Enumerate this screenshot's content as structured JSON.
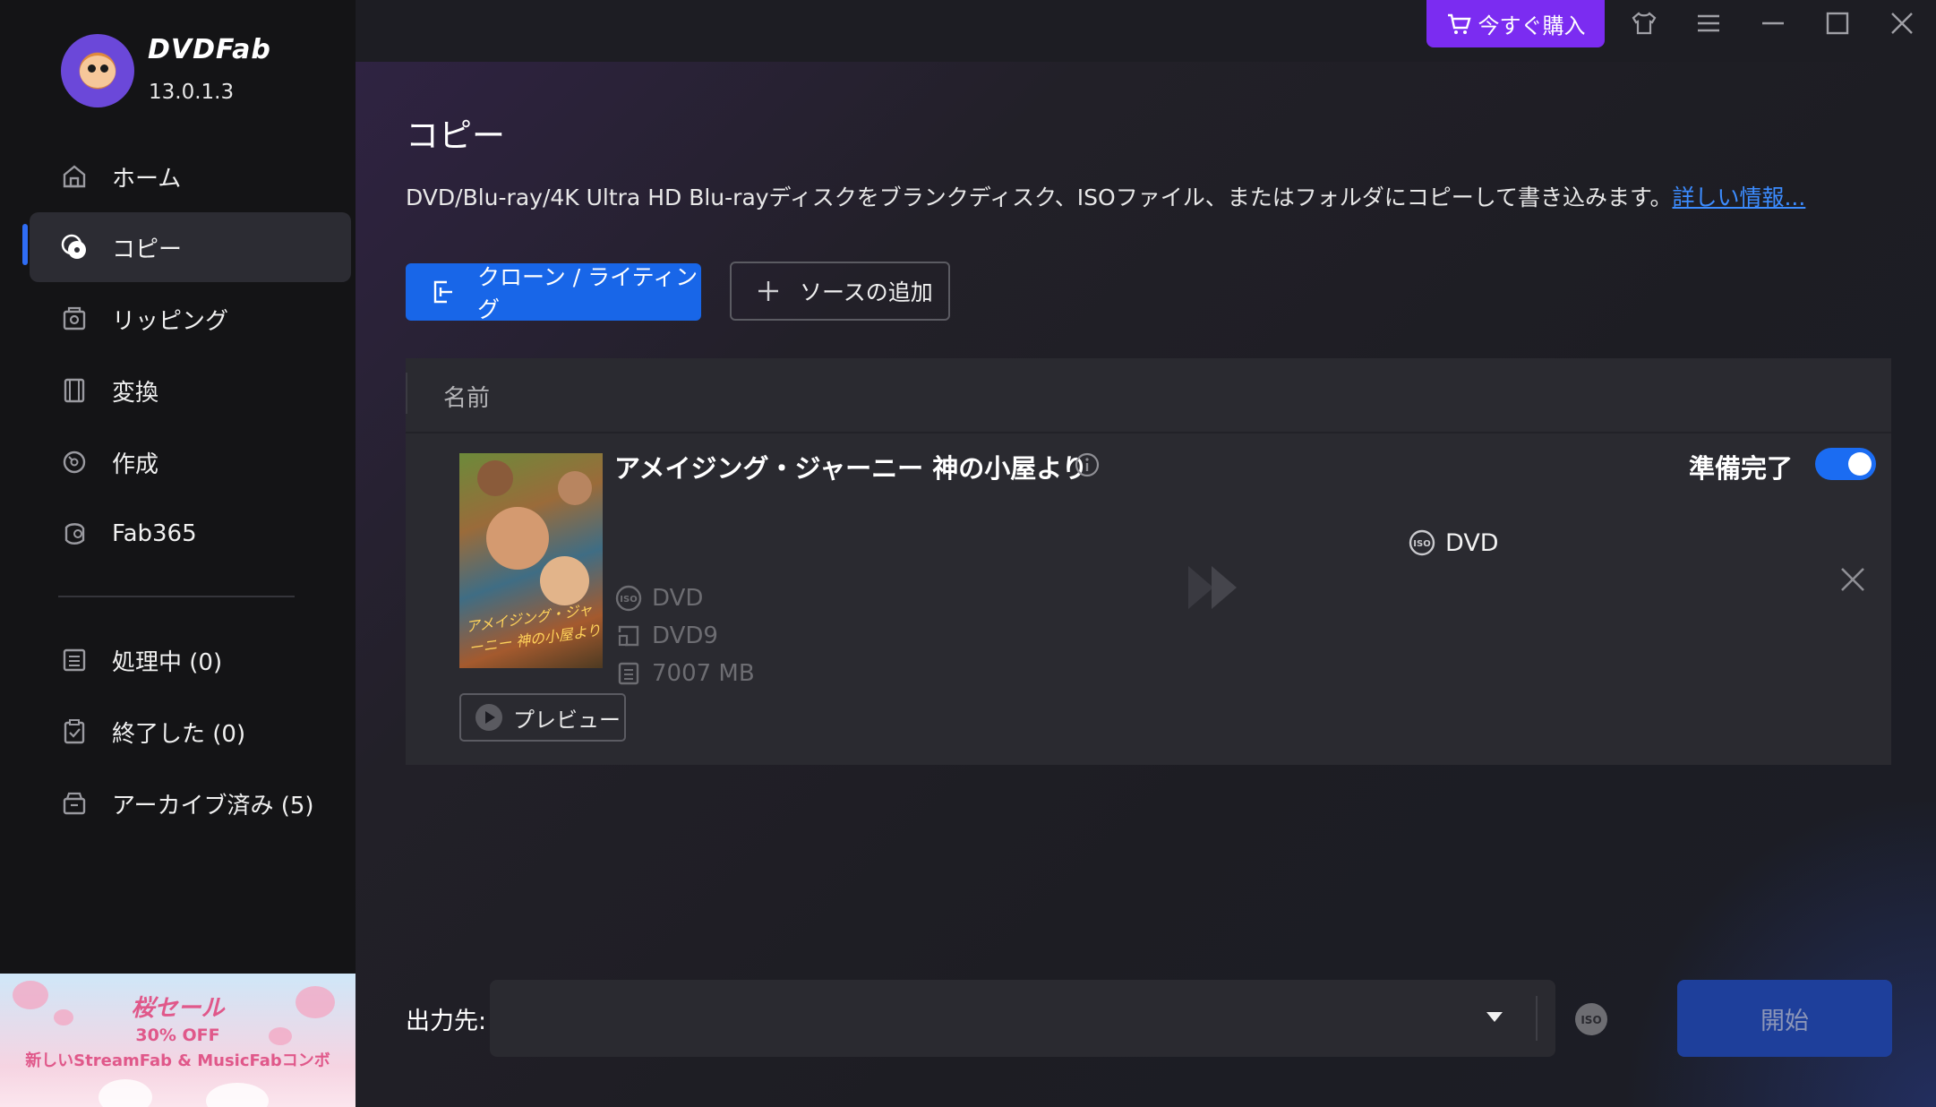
{
  "app": {
    "brand": "DVDFab",
    "version": "13.0.1.3"
  },
  "topbar": {
    "buy_label": "今すぐ購入"
  },
  "sidebar": {
    "items": [
      {
        "label": "ホーム",
        "icon": "home-icon"
      },
      {
        "label": "コピー",
        "icon": "disc-copy-icon",
        "active": true
      },
      {
        "label": "リッピング",
        "icon": "rip-icon"
      },
      {
        "label": "変換",
        "icon": "film-icon"
      },
      {
        "label": "作成",
        "icon": "create-disc-icon"
      },
      {
        "label": "Fab365",
        "icon": "fab365-icon"
      }
    ],
    "queue": [
      {
        "label": "処理中 (0)",
        "icon": "processing-list-icon"
      },
      {
        "label": "終了した (0)",
        "icon": "clipboard-check-icon"
      },
      {
        "label": "アーカイブ済み (5)",
        "icon": "archive-icon"
      }
    ],
    "promo": {
      "title": "桜セール",
      "discount": "30% OFF",
      "subtitle": "新しいStreamFab & MusicFabコンボ"
    }
  },
  "main": {
    "title": "コピー",
    "description": "DVD/Blu-ray/4K Ultra HD Blu-rayディスクをブランクディスク、ISOファイル、またはフォルダにコピーして書き込みます。",
    "more_link": "詳しい情報...",
    "clone_button": "クローン / ライティング",
    "add_source_button": "ソースの追加",
    "table": {
      "column_name": "名前",
      "item": {
        "title": "アメイジング・ジャーニー 神の小屋より",
        "status": "準備完了",
        "toggle_on": true,
        "source": {
          "type": "DVD",
          "disc": "DVD9",
          "size": "7007 MB"
        },
        "target": "DVD",
        "preview_button": "プレビュー",
        "poster_title": "アメイジング・ジャーニー 神の小屋より"
      }
    },
    "output": {
      "label": "出力先:",
      "value": "",
      "start_button": "開始"
    }
  },
  "colors": {
    "accent": "#1866e8",
    "buy": "#7b2cf1",
    "sidebar_bg": "#141416",
    "active_item": "#2c2c33"
  }
}
